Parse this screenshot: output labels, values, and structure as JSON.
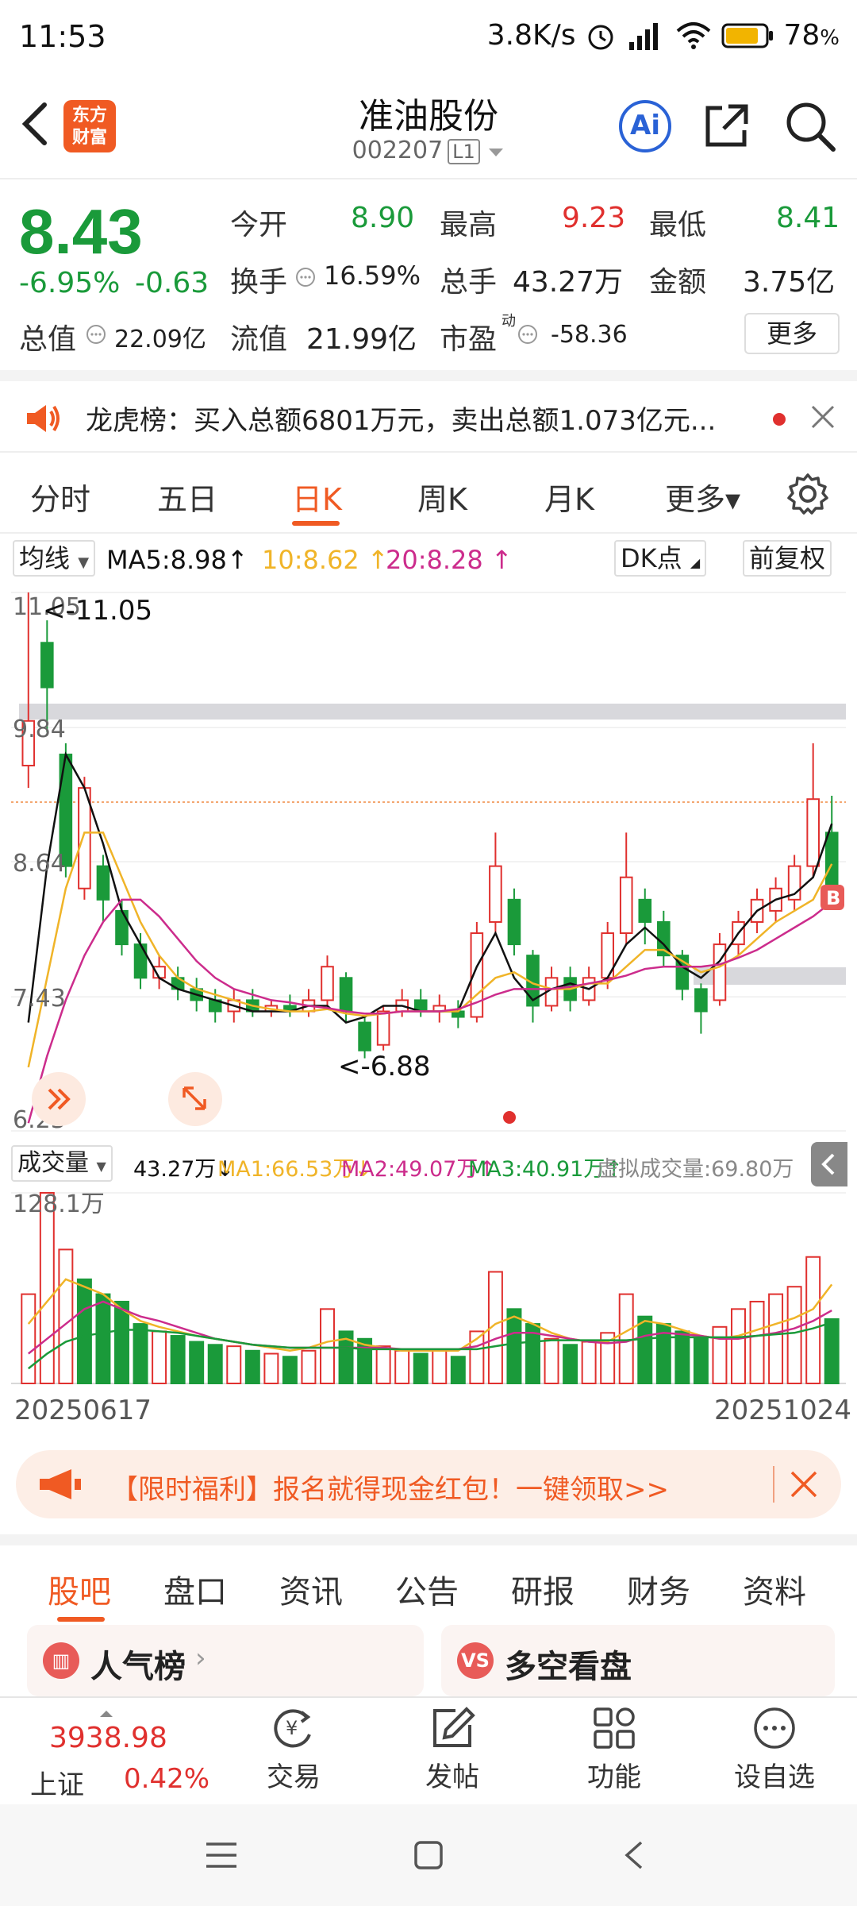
{
  "status_bar": {
    "time": "11:53",
    "net_speed": "3.8K/s",
    "battery": "78",
    "battery_unit": "%"
  },
  "header": {
    "logo_line1": "东方",
    "logo_line2": "财富",
    "stock_name": "准油股份",
    "stock_code": "002207",
    "level": "L1",
    "ai_label": "Ai"
  },
  "quote": {
    "price": "8.43",
    "change_pct": "-6.95%",
    "change": "-0.63",
    "open_label": "今开",
    "open": "8.90",
    "high_label": "最高",
    "high": "9.23",
    "low_label": "最低",
    "low": "8.41",
    "turnover_label": "换手",
    "turnover": "16.59%",
    "volume_label": "总手",
    "volume": "43.27万",
    "amount_label": "金额",
    "amount": "3.75亿",
    "mktcap_label": "总值",
    "mktcap": "22.09亿",
    "float_label": "流值",
    "float_cap": "21.99亿",
    "pe_label": "市盈",
    "pe_sup": "动",
    "pe": "-58.36",
    "more": "更多"
  },
  "notice": {
    "text": "龙虎榜：买入总额6801万元，卖出总额1.073亿元..."
  },
  "kline_tabs": [
    {
      "label": "分时"
    },
    {
      "label": "五日"
    },
    {
      "label": "日K"
    },
    {
      "label": "周K"
    },
    {
      "label": "月K"
    },
    {
      "label": "更多▾"
    }
  ],
  "ma_legend": {
    "selector": "均线",
    "ma5": "MA5:8.98",
    "ma10": "10:8.62",
    "ma20": "20:8.28",
    "dk": "DK点",
    "adjust": "前复权"
  },
  "colors": {
    "up": "#e0302e",
    "down": "#1a9a3a",
    "accent": "#f05a23",
    "ma5": "#111111",
    "ma10": "#f0b428",
    "ma20": "#cc2c8c"
  },
  "chart_data": [
    {
      "type": "candlestick",
      "title": "",
      "ylim": [
        6.23,
        11.05
      ],
      "y_ticks": [
        "11.05",
        "9.84",
        "8.64",
        "7.43",
        "6.23"
      ],
      "annotations": [
        "<-11.05",
        "<-6.88"
      ],
      "x_start": "20250617",
      "x_end": "20251024",
      "series": [
        {
          "name": "MA5",
          "values": [
            7.2,
            8.6,
            9.6,
            9.3,
            8.8,
            8.2,
            7.9,
            7.6,
            7.5,
            7.45,
            7.4,
            7.35,
            7.3,
            7.3,
            7.3,
            7.35,
            7.35,
            7.2,
            7.25,
            7.35,
            7.35,
            7.3,
            7.3,
            7.3,
            7.7,
            8.0,
            7.6,
            7.4,
            7.5,
            7.55,
            7.5,
            7.6,
            7.9,
            8.05,
            7.9,
            7.7,
            7.6,
            7.75,
            8.0,
            8.2,
            8.3,
            8.35,
            8.5,
            8.98
          ]
        },
        {
          "name": "10",
          "values": [
            6.8,
            7.6,
            8.4,
            8.9,
            8.9,
            8.5,
            8.1,
            7.8,
            7.6,
            7.5,
            7.45,
            7.4,
            7.35,
            7.32,
            7.3,
            7.3,
            7.32,
            7.28,
            7.26,
            7.28,
            7.3,
            7.3,
            7.3,
            7.3,
            7.45,
            7.6,
            7.65,
            7.55,
            7.5,
            7.5,
            7.55,
            7.55,
            7.7,
            7.85,
            7.85,
            7.75,
            7.65,
            7.7,
            7.8,
            7.95,
            8.1,
            8.2,
            8.3,
            8.62
          ]
        },
        {
          "name": "20",
          "values": [
            6.3,
            6.9,
            7.4,
            7.8,
            8.1,
            8.3,
            8.3,
            8.15,
            7.95,
            7.75,
            7.6,
            7.5,
            7.45,
            7.4,
            7.38,
            7.35,
            7.33,
            7.3,
            7.28,
            7.28,
            7.3,
            7.3,
            7.3,
            7.32,
            7.38,
            7.45,
            7.5,
            7.5,
            7.5,
            7.52,
            7.55,
            7.58,
            7.62,
            7.68,
            7.7,
            7.7,
            7.7,
            7.72,
            7.78,
            7.85,
            7.95,
            8.05,
            8.15,
            8.28
          ]
        }
      ],
      "candles": [
        {
          "o": 9.5,
          "c": 9.9,
          "h": 11.05,
          "l": 9.3
        },
        {
          "o": 10.6,
          "c": 10.2,
          "h": 10.8,
          "l": 9.8
        },
        {
          "o": 9.6,
          "c": 8.6,
          "h": 9.7,
          "l": 8.5
        },
        {
          "o": 8.4,
          "c": 9.3,
          "h": 9.4,
          "l": 8.3
        },
        {
          "o": 8.6,
          "c": 8.3,
          "h": 8.7,
          "l": 8.1
        },
        {
          "o": 8.2,
          "c": 7.9,
          "h": 8.3,
          "l": 7.8
        },
        {
          "o": 7.9,
          "c": 7.6,
          "h": 8.0,
          "l": 7.5
        },
        {
          "o": 7.6,
          "c": 7.7,
          "h": 7.8,
          "l": 7.5
        },
        {
          "o": 7.6,
          "c": 7.5,
          "h": 7.7,
          "l": 7.4
        },
        {
          "o": 7.5,
          "c": 7.4,
          "h": 7.6,
          "l": 7.3
        },
        {
          "o": 7.4,
          "c": 7.3,
          "h": 7.5,
          "l": 7.2
        },
        {
          "o": 7.3,
          "c": 7.4,
          "h": 7.5,
          "l": 7.2
        },
        {
          "o": 7.4,
          "c": 7.3,
          "h": 7.5,
          "l": 7.25
        },
        {
          "o": 7.3,
          "c": 7.35,
          "h": 7.4,
          "l": 7.25
        },
        {
          "o": 7.35,
          "c": 7.3,
          "h": 7.45,
          "l": 7.25
        },
        {
          "o": 7.3,
          "c": 7.4,
          "h": 7.5,
          "l": 7.25
        },
        {
          "o": 7.4,
          "c": 7.7,
          "h": 7.8,
          "l": 7.35
        },
        {
          "o": 7.6,
          "c": 7.3,
          "h": 7.65,
          "l": 7.2
        },
        {
          "o": 7.2,
          "c": 6.95,
          "h": 7.25,
          "l": 6.88
        },
        {
          "o": 7.0,
          "c": 7.3,
          "h": 7.35,
          "l": 6.95
        },
        {
          "o": 7.3,
          "c": 7.4,
          "h": 7.5,
          "l": 7.25
        },
        {
          "o": 7.4,
          "c": 7.3,
          "h": 7.5,
          "l": 7.25
        },
        {
          "o": 7.3,
          "c": 7.35,
          "h": 7.45,
          "l": 7.2
        },
        {
          "o": 7.3,
          "c": 7.25,
          "h": 7.4,
          "l": 7.15
        },
        {
          "o": 7.25,
          "c": 8.0,
          "h": 8.1,
          "l": 7.2
        },
        {
          "o": 8.1,
          "c": 8.6,
          "h": 8.9,
          "l": 8.0
        },
        {
          "o": 8.3,
          "c": 7.9,
          "h": 8.4,
          "l": 7.8
        },
        {
          "o": 7.8,
          "c": 7.35,
          "h": 7.85,
          "l": 7.2
        },
        {
          "o": 7.35,
          "c": 7.6,
          "h": 7.7,
          "l": 7.3
        },
        {
          "o": 7.6,
          "c": 7.4,
          "h": 7.7,
          "l": 7.3
        },
        {
          "o": 7.4,
          "c": 7.6,
          "h": 7.7,
          "l": 7.35
        },
        {
          "o": 7.6,
          "c": 8.0,
          "h": 8.1,
          "l": 7.5
        },
        {
          "o": 8.0,
          "c": 8.5,
          "h": 8.9,
          "l": 7.9
        },
        {
          "o": 8.3,
          "c": 8.1,
          "h": 8.4,
          "l": 7.9
        },
        {
          "o": 8.1,
          "c": 7.8,
          "h": 8.2,
          "l": 7.7
        },
        {
          "o": 7.8,
          "c": 7.5,
          "h": 7.85,
          "l": 7.4
        },
        {
          "o": 7.5,
          "c": 7.3,
          "h": 7.55,
          "l": 7.1
        },
        {
          "o": 7.4,
          "c": 7.9,
          "h": 8.0,
          "l": 7.35
        },
        {
          "o": 7.9,
          "c": 8.1,
          "h": 8.2,
          "l": 7.8
        },
        {
          "o": 8.1,
          "c": 8.3,
          "h": 8.4,
          "l": 8.0
        },
        {
          "o": 8.2,
          "c": 8.4,
          "h": 8.5,
          "l": 8.1
        },
        {
          "o": 8.3,
          "c": 8.6,
          "h": 8.7,
          "l": 8.2
        },
        {
          "o": 8.6,
          "c": 9.2,
          "h": 9.7,
          "l": 8.5
        },
        {
          "o": 8.9,
          "c": 8.43,
          "h": 9.23,
          "l": 8.41
        }
      ]
    },
    {
      "type": "bar",
      "title": "",
      "ylim": [
        0,
        128.1
      ],
      "y_ticks": [
        "128.1万"
      ],
      "series": [
        {
          "name": "MA1:66.53万",
          "values": [
            40,
            55,
            70,
            65,
            60,
            50,
            42,
            38,
            35,
            32,
            30,
            28,
            26,
            24,
            22,
            24,
            28,
            30,
            26,
            24,
            22,
            22,
            22,
            22,
            30,
            40,
            45,
            40,
            34,
            30,
            28,
            28,
            35,
            42,
            40,
            36,
            32,
            30,
            32,
            36,
            40,
            44,
            50,
            66.53
          ]
        },
        {
          "name": "MA2:49.07万",
          "values": [
            20,
            30,
            40,
            50,
            55,
            50,
            45,
            42,
            38,
            34,
            30,
            28,
            26,
            25,
            24,
            24,
            24,
            24,
            24,
            24,
            23,
            23,
            23,
            23,
            25,
            30,
            34,
            34,
            32,
            30,
            28,
            27,
            28,
            32,
            34,
            33,
            32,
            30,
            30,
            32,
            34,
            37,
            42,
            49.07
          ]
        },
        {
          "name": "MA3:40.91万",
          "values": [
            10,
            20,
            28,
            32,
            34,
            36,
            36,
            35,
            34,
            32,
            30,
            28,
            26,
            25,
            24,
            24,
            24,
            24,
            23,
            23,
            23,
            23,
            23,
            23,
            23,
            25,
            27,
            28,
            29,
            29,
            29,
            29,
            29,
            30,
            31,
            31,
            31,
            31,
            31,
            32,
            33,
            34,
            37,
            40.91
          ]
        }
      ],
      "values": [
        60,
        128.1,
        90,
        70,
        60,
        55,
        40,
        35,
        32,
        28,
        26,
        25,
        22,
        20,
        18,
        22,
        50,
        35,
        30,
        25,
        22,
        20,
        22,
        18,
        35,
        75,
        50,
        40,
        30,
        26,
        28,
        34,
        60,
        45,
        40,
        35,
        30,
        38,
        50,
        55,
        60,
        65,
        85,
        43.27
      ],
      "directions": [
        "up",
        "up",
        "up",
        "down",
        "down",
        "down",
        "down",
        "up",
        "down",
        "down",
        "down",
        "up",
        "down",
        "up",
        "down",
        "up",
        "up",
        "down",
        "down",
        "up",
        "up",
        "down",
        "up",
        "down",
        "up",
        "up",
        "down",
        "down",
        "up",
        "down",
        "up",
        "up",
        "up",
        "down",
        "down",
        "down",
        "down",
        "up",
        "up",
        "up",
        "up",
        "up",
        "up",
        "down"
      ]
    }
  ],
  "volume_legend": {
    "selector": "成交量",
    "vol": "43.27万",
    "ma1": "MA1:66.53万",
    "ma2": "MA2:49.07万",
    "ma3": "MA3:40.91万",
    "virtual": "虚拟成交量:69.80万"
  },
  "date_range": {
    "start": "20250617",
    "end": "20251024"
  },
  "banner": {
    "text": "【限时福利】报名就得现金红包！一键领取>>"
  },
  "bottom_tabs": [
    {
      "label": "股吧"
    },
    {
      "label": "盘口"
    },
    {
      "label": "资讯"
    },
    {
      "label": "公告"
    },
    {
      "label": "研报"
    },
    {
      "label": "财务"
    },
    {
      "label": "资料"
    }
  ],
  "cards": {
    "left": "人气榜",
    "right": "多空看盘",
    "right_icon": "VS"
  },
  "bottom_nav": {
    "index_value": "3938.98",
    "index_name": "上证",
    "index_change": "0.42%",
    "trade": "交易",
    "post": "发帖",
    "functions": "功能",
    "watchlist": "设自选"
  }
}
